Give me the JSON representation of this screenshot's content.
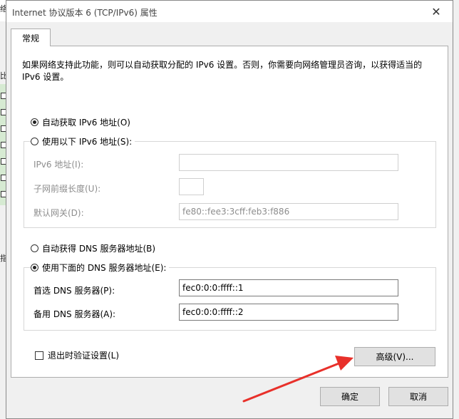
{
  "background": {
    "fragments": [
      "络",
      "比",
      "指"
    ]
  },
  "dialog": {
    "title": "Internet 协议版本 6 (TCP/IPv6) 属性",
    "close_icon": "close-icon",
    "tab": "常规",
    "description": "如果网络支持此功能，则可以自动获取分配的 IPv6 设置。否则，你需要向网络管理员咨询，以获得适当的 IPv6 设置。",
    "ip_mode": {
      "auto_label": "自动获取 IPv6 地址(O)",
      "manual_label": "使用以下 IPv6 地址(S):",
      "selected": "auto"
    },
    "ipv6_fields": {
      "address_label": "IPv6 地址(I):",
      "address_value": "",
      "prefix_label": "子网前缀长度(U):",
      "prefix_value": "",
      "gateway_label": "默认网关(D):",
      "gateway_value": "fe80::fee3:3cff:feb3:f886"
    },
    "dns_mode": {
      "auto_label": "自动获得 DNS 服务器地址(B)",
      "manual_label": "使用下面的 DNS 服务器地址(E):",
      "selected": "manual"
    },
    "dns_fields": {
      "preferred_label": "首选 DNS 服务器(P):",
      "preferred_value": "fec0:0:0:ffff::1",
      "alternate_label": "备用 DNS 服务器(A):",
      "alternate_value": "fec0:0:0:ffff::2"
    },
    "validate_on_exit": {
      "label": "退出时验证设置(L)",
      "checked": false
    },
    "buttons": {
      "advanced": "高级(V)...",
      "ok": "确定",
      "cancel": "取消"
    },
    "annotation_color": "#e8302a"
  }
}
